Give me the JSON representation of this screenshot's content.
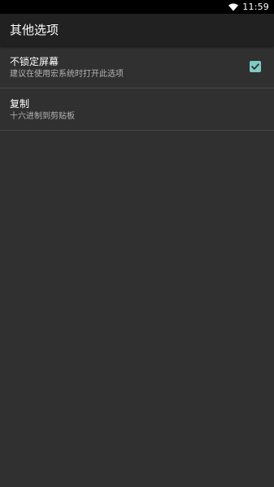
{
  "status_bar": {
    "time": "11:59",
    "icons": [
      "wifi-icon"
    ]
  },
  "app_bar": {
    "title": "其他选项"
  },
  "preferences": [
    {
      "title": "不锁定屏幕",
      "summary": "建议在使用宏系统时打开此选项",
      "checked": true
    },
    {
      "title": "复制",
      "summary": "十六进制到剪贴板"
    }
  ],
  "colors": {
    "background": "#303030",
    "app_bar": "#212121",
    "status_bar": "#000000",
    "accent": "#80cbc4",
    "divider": "#474747"
  }
}
